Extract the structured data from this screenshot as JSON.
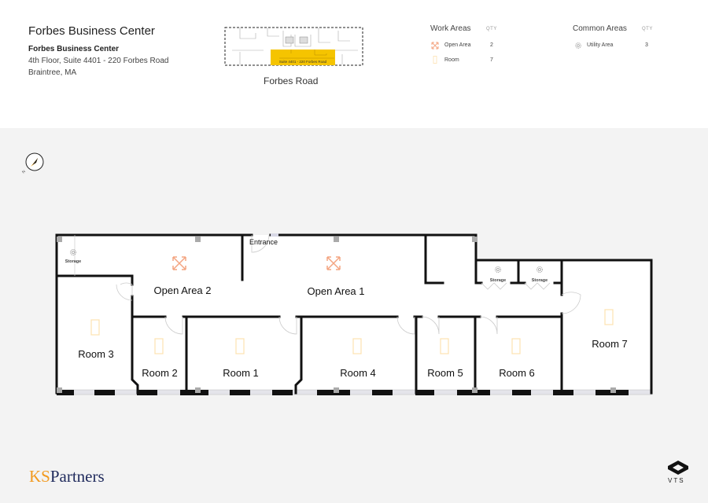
{
  "header": {
    "title": "Forbes Business Center",
    "building_name": "Forbes Business Center",
    "address_line1": "4th Floor, Suite 4401 - 220 Forbes Road",
    "address_line2": "Braintree, MA",
    "keymap_label": "Suite 4401 - 220 Forbes Road",
    "keymap_highlight_color": "#f5c400",
    "road_label": "Forbes Road"
  },
  "legend": {
    "work_areas": {
      "title": "Work Areas",
      "qty_label": "QTY",
      "items": [
        {
          "icon": "open-area-arrows-icon",
          "label": "Open Area",
          "qty": "2",
          "color": "#f4a582"
        },
        {
          "icon": "room-door-icon",
          "label": "Room",
          "qty": "7",
          "color": "#fde2b0"
        }
      ]
    },
    "common_areas": {
      "title": "Common Areas",
      "qty_label": "QTY",
      "items": [
        {
          "icon": "gear-icon",
          "label": "Utility Area",
          "qty": "3",
          "color": "#999999"
        }
      ]
    }
  },
  "floorplan": {
    "entrance_label": "Entrance",
    "open_areas": [
      {
        "id": "open-area-2",
        "label": "Open Area 2"
      },
      {
        "id": "open-area-1",
        "label": "Open Area 1"
      }
    ],
    "rooms": [
      {
        "id": "room-3",
        "label": "Room 3"
      },
      {
        "id": "room-2",
        "label": "Room 2"
      },
      {
        "id": "room-1",
        "label": "Room 1"
      },
      {
        "id": "room-4",
        "label": "Room 4"
      },
      {
        "id": "room-5",
        "label": "Room 5"
      },
      {
        "id": "room-6",
        "label": "Room 6"
      },
      {
        "id": "room-7",
        "label": "Room 7"
      }
    ],
    "storage": [
      {
        "id": "storage-1",
        "label": "Storage"
      },
      {
        "id": "storage-2",
        "label": "Storage"
      },
      {
        "id": "storage-3",
        "label": "Storage"
      }
    ],
    "wall_color": "#111111",
    "open_area_icon_color": "#f4a582",
    "room_icon_color": "#fde2b0"
  },
  "footer": {
    "brand_left_ks": "KS",
    "brand_left_partners": "Partners",
    "brand_right": "VTS"
  }
}
